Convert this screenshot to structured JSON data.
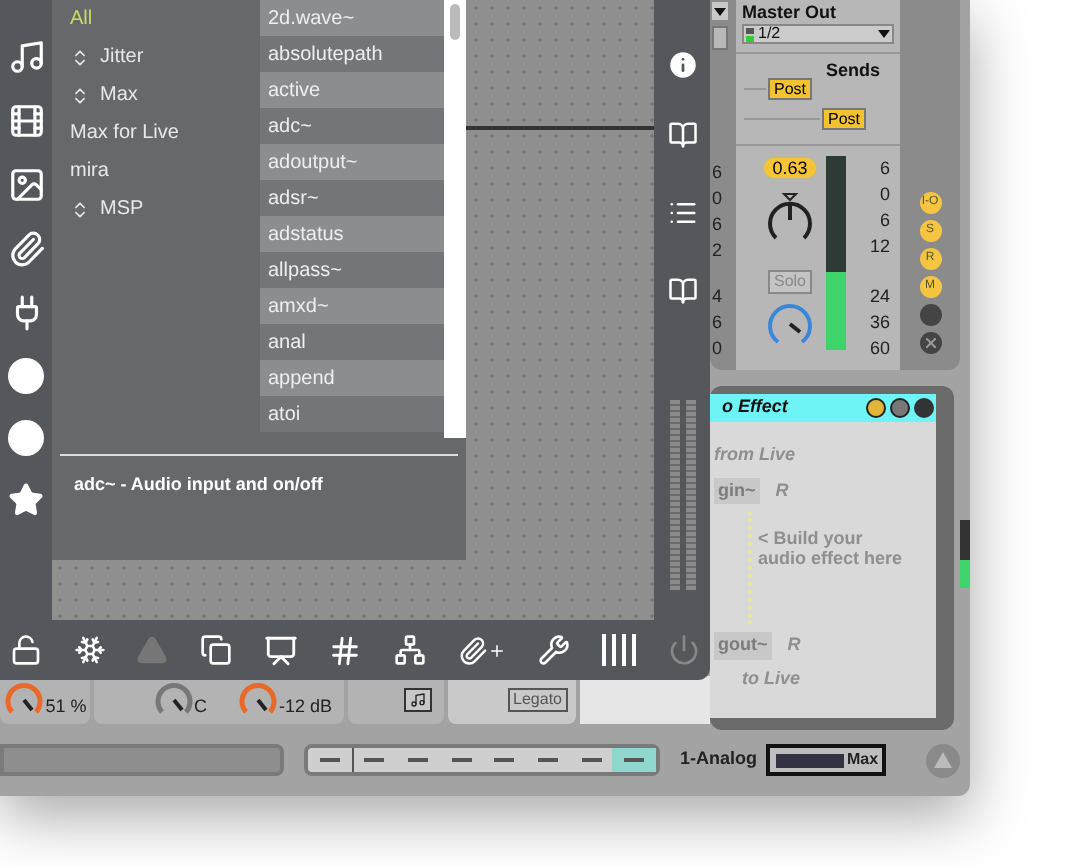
{
  "browser": {
    "categories": [
      {
        "label": "All",
        "selected": true,
        "expandable": false
      },
      {
        "label": "Jitter",
        "selected": false,
        "expandable": true
      },
      {
        "label": "Max",
        "selected": false,
        "expandable": true
      },
      {
        "label": "Max for Live",
        "selected": false,
        "expandable": false
      },
      {
        "label": "mira",
        "selected": false,
        "expandable": false
      },
      {
        "label": "MSP",
        "selected": false,
        "expandable": true
      }
    ],
    "objects": [
      "2d.wave~",
      "absolutepath",
      "active",
      "adc~",
      "adoutput~",
      "adsr~",
      "adstatus",
      "allpass~",
      "amxd~",
      "anal",
      "append",
      "atoi"
    ],
    "description": "adc~ - Audio input and on/off"
  },
  "mixer": {
    "partial_scale": [
      "6",
      "0",
      "6",
      "2",
      "4",
      "6",
      "0"
    ],
    "output_label": "Master Out",
    "output_value": "1/2",
    "sends_label": "Sends",
    "send_buttons": [
      "Post",
      "Post"
    ],
    "volume": "0.63",
    "solo": "Solo",
    "meter": {
      "level": 0.4
    },
    "scale": [
      "6",
      "0",
      "6",
      "12",
      "24",
      "36",
      "60"
    ]
  },
  "track_buttons": [
    {
      "label": "I-O"
    },
    {
      "label": "S"
    },
    {
      "label": "R"
    },
    {
      "label": "M"
    }
  ],
  "device": {
    "title": "o Effect",
    "from_label": "from Live",
    "input_object": "gin~",
    "input_mark": "R",
    "hint": "< Build your audio effect here",
    "output_object": "gout~",
    "output_mark": "R",
    "to_label": "to Live",
    "meter": {
      "level": 0.4
    }
  },
  "clip_controls": {
    "readings": [
      "51 %",
      "C",
      "-12 dB"
    ],
    "legato": "Legato"
  },
  "sequencer": {
    "steps": [
      {
        "selected": false
      },
      {
        "selected": false
      },
      {
        "selected": false
      },
      {
        "selected": false
      },
      {
        "selected": false
      },
      {
        "selected": false
      },
      {
        "selected": false
      },
      {
        "selected": true
      }
    ]
  },
  "footer": {
    "track_name": "1-Analog",
    "device_label": "Max"
  }
}
